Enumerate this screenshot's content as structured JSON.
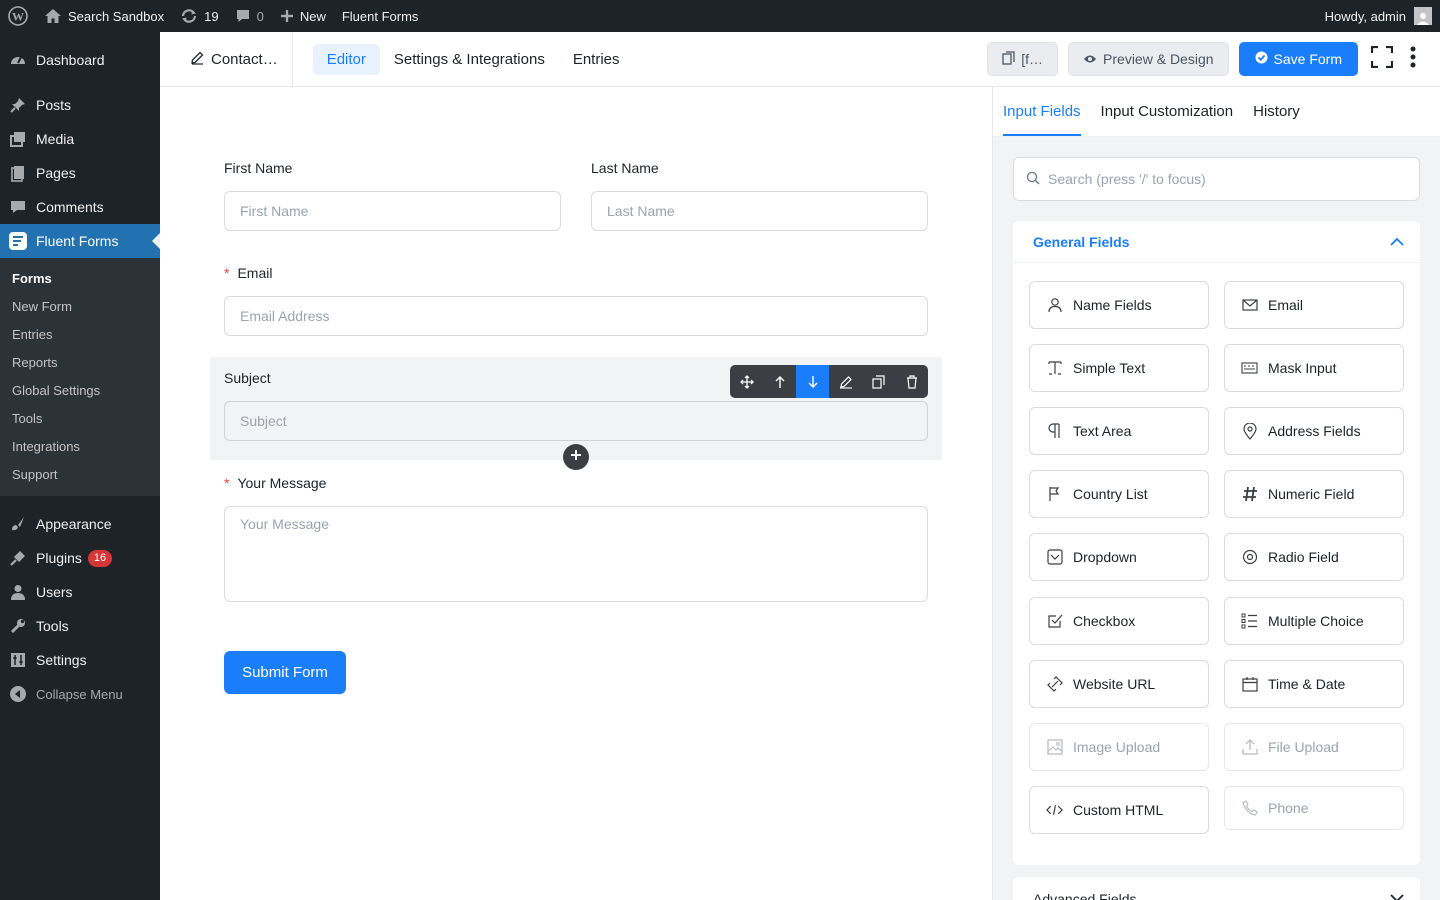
{
  "admin_bar": {
    "site_name": "Search Sandbox",
    "updates_count": "19",
    "comments_count": "0",
    "new_label": "New",
    "plugin_label": "Fluent Forms",
    "greeting": "Howdy, admin"
  },
  "sidebar": {
    "dashboard": "Dashboard",
    "posts": "Posts",
    "media": "Media",
    "pages": "Pages",
    "comments": "Comments",
    "fluent_forms": "Fluent Forms",
    "submenu": [
      "Forms",
      "New Form",
      "Entries",
      "Reports",
      "Global Settings",
      "Tools",
      "Integrations",
      "Support"
    ],
    "appearance": "Appearance",
    "plugins": "Plugins",
    "plugins_badge": "16",
    "users": "Users",
    "tools": "Tools",
    "settings": "Settings",
    "collapse": "Collapse Menu"
  },
  "topbar": {
    "form_title": "Contact…",
    "tabs": [
      "Editor",
      "Settings & Integrations",
      "Entries"
    ],
    "shortcode_label": "[f…",
    "preview_label": "Preview & Design",
    "save_label": "Save Form"
  },
  "form": {
    "first_name_label": "First Name",
    "first_name_placeholder": "First Name",
    "last_name_label": "Last Name",
    "last_name_placeholder": "Last Name",
    "email_label": "Email",
    "email_placeholder": "Email Address",
    "subject_label": "Subject",
    "subject_placeholder": "Subject",
    "message_label": "Your Message",
    "message_placeholder": "Your Message",
    "required_mark": "*",
    "submit_label": "Submit Form"
  },
  "panel": {
    "tabs": [
      "Input Fields",
      "Input Customization",
      "History"
    ],
    "search_placeholder": "Search (press '/' to focus)",
    "general_title": "General Fields",
    "fields": [
      {
        "label": "Name Fields",
        "icon": "user-icon"
      },
      {
        "label": "Email",
        "icon": "envelope-icon"
      },
      {
        "label": "Simple Text",
        "icon": "text-cursor-icon"
      },
      {
        "label": "Mask Input",
        "icon": "keyboard-icon"
      },
      {
        "label": "Text Area",
        "icon": "paragraph-icon"
      },
      {
        "label": "Address Fields",
        "icon": "map-pin-icon"
      },
      {
        "label": "Country List",
        "icon": "flag-icon"
      },
      {
        "label": "Numeric Field",
        "icon": "hash-icon"
      },
      {
        "label": "Dropdown",
        "icon": "dropdown-icon"
      },
      {
        "label": "Radio Field",
        "icon": "radio-icon"
      },
      {
        "label": "Checkbox",
        "icon": "checkbox-icon"
      },
      {
        "label": "Multiple Choice",
        "icon": "list-icon"
      },
      {
        "label": "Website URL",
        "icon": "link-icon"
      },
      {
        "label": "Time & Date",
        "icon": "calendar-icon"
      },
      {
        "label": "Image Upload",
        "icon": "image-icon"
      },
      {
        "label": "File Upload",
        "icon": "upload-icon"
      },
      {
        "label": "Custom HTML",
        "icon": "code-icon"
      },
      {
        "label": "Phone",
        "icon": "phone-icon"
      }
    ],
    "advanced_title": "Advanced Fields"
  },
  "colors": {
    "accent": "#1a7efb",
    "wp_dark": "#1d2327",
    "wp_active": "#2271b1",
    "badge": "#d63638"
  }
}
